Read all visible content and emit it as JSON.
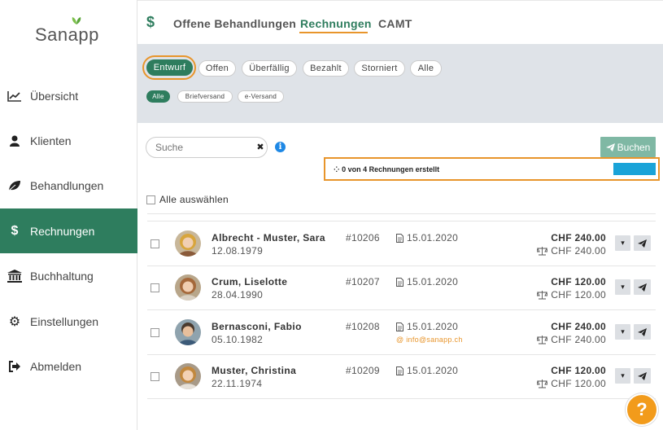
{
  "app": {
    "logo": "Sanapp"
  },
  "sidebar": {
    "items": [
      {
        "label": "Übersicht",
        "icon": "chart-line-icon"
      },
      {
        "label": "Klienten",
        "icon": "user-icon"
      },
      {
        "label": "Behandlungen",
        "icon": "leaf-icon"
      },
      {
        "label": "Rechnungen",
        "icon": "dollar-icon",
        "active": true
      },
      {
        "label": "Buchhaltung",
        "icon": "bank-icon"
      },
      {
        "label": "Einstellungen",
        "icon": "gear-icon"
      },
      {
        "label": "Abmelden",
        "icon": "sign-out-icon"
      }
    ]
  },
  "header": {
    "symbol": "$",
    "tabs": [
      {
        "label": "Offene Behandlungen"
      },
      {
        "label": "Rechnungen",
        "active": true
      },
      {
        "label": "CAMT"
      }
    ]
  },
  "filters": {
    "status": [
      "Entwurf",
      "Offen",
      "Überfällig",
      "Bezahlt",
      "Storniert",
      "Alle"
    ],
    "delivery": [
      "Alle",
      "Briefversand",
      "e-Versand"
    ]
  },
  "toolbar": {
    "search_placeholder": "Suche",
    "buchen_label": "Buchen",
    "progress_text": "0 von 4 Rechnungen erstellt",
    "select_all_label": "Alle auswählen"
  },
  "invoices": [
    {
      "name": "Albrecht - Muster, Sara",
      "dob": "12.08.1979",
      "number": "#10206",
      "date": "15.01.2020",
      "email": "",
      "amount": "CHF 240.00",
      "amount_balance": "CHF 240.00"
    },
    {
      "name": "Crum, Liselotte",
      "dob": "28.04.1990",
      "number": "#10207",
      "date": "15.01.2020",
      "email": "",
      "amount": "CHF 120.00",
      "amount_balance": "CHF 120.00"
    },
    {
      "name": "Bernasconi, Fabio",
      "dob": "05.10.1982",
      "number": "#10208",
      "date": "15.01.2020",
      "email": "info@sanapp.ch",
      "amount": "CHF 240.00",
      "amount_balance": "CHF 240.00"
    },
    {
      "name": "Muster, Christina",
      "dob": "22.11.1974",
      "number": "#10209",
      "date": "15.01.2020",
      "email": "",
      "amount": "CHF 120.00",
      "amount_balance": "CHF 120.00"
    }
  ],
  "help": {
    "label": "?"
  },
  "colors": {
    "primary": "#2e7d5e",
    "accent": "#e8952b",
    "progress": "#1aa3d8",
    "help": "#f29b1b"
  }
}
